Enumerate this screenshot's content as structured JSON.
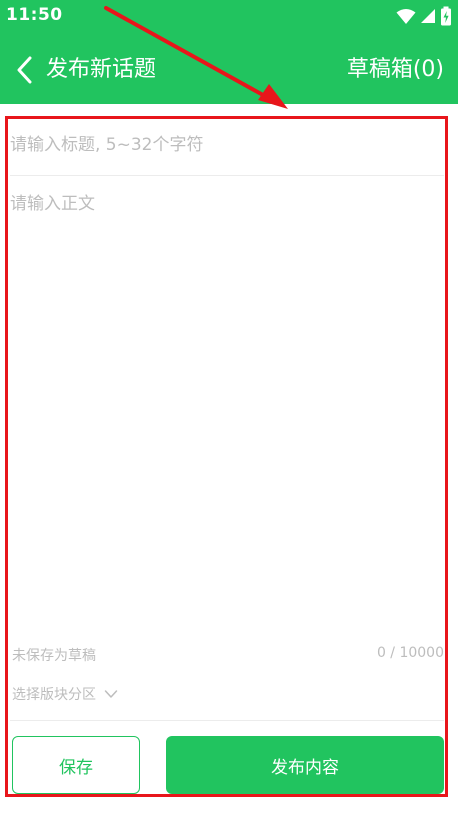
{
  "status_bar": {
    "time": "11:50",
    "icons": [
      "wifi-icon",
      "cellular-signal-icon",
      "battery-icon"
    ]
  },
  "app_bar": {
    "back_icon": "chevron-left-icon",
    "title": "发布新话题",
    "drafts_label": "草稿箱(0)"
  },
  "editor": {
    "title_placeholder": "请输入标题, 5~32个字符",
    "title_value": "",
    "body_placeholder": "请输入正文",
    "body_value": "",
    "draft_status": "未保存为草稿",
    "char_count": "0 / 10000",
    "section_selector_label": "选择版块分区",
    "section_selector_icon": "chevron-down-icon"
  },
  "actions": {
    "save_label": "保存",
    "publish_label": "发布内容"
  },
  "colors": {
    "brand_green": "#21c45f",
    "placeholder_gray": "#bdbdbd",
    "annotation_red": "#e8161b"
  }
}
